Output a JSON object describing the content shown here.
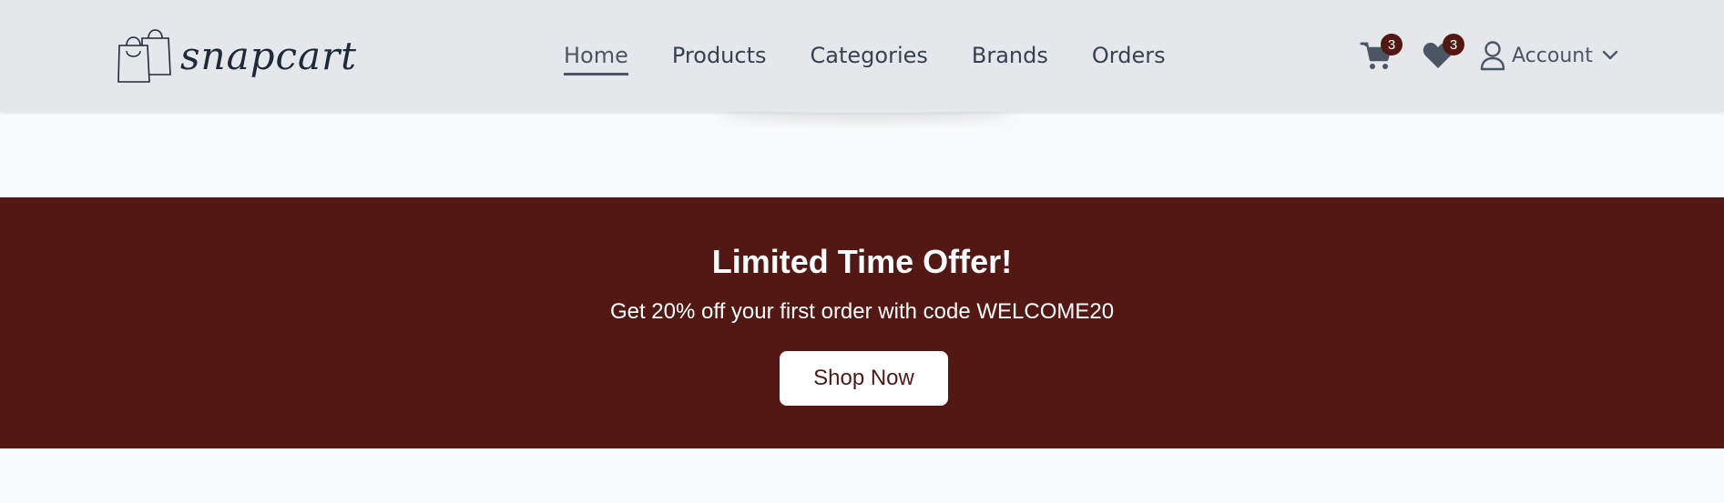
{
  "brand": {
    "name": "snapcart",
    "logo_icon": "shopping-bags-icon"
  },
  "nav": {
    "items": [
      {
        "label": "Home",
        "active": true
      },
      {
        "label": "Products",
        "active": false
      },
      {
        "label": "Categories",
        "active": false
      },
      {
        "label": "Brands",
        "active": false
      },
      {
        "label": "Orders",
        "active": false
      }
    ]
  },
  "header_actions": {
    "cart": {
      "icon": "cart-icon",
      "count": "3"
    },
    "wishlist": {
      "icon": "heart-icon",
      "count": "3"
    },
    "account": {
      "icon": "user-icon",
      "label": "Account",
      "chevron": "chevron-down-icon"
    }
  },
  "promo": {
    "title": "Limited Time Offer!",
    "subtitle": "Get 20% off your first order with code WELCOME20",
    "button_label": "Shop Now"
  },
  "colors": {
    "header_bg": "#e5e7eb",
    "page_bg": "#f9fafb",
    "brand_accent": "#531813",
    "nav_text": "#374151"
  }
}
